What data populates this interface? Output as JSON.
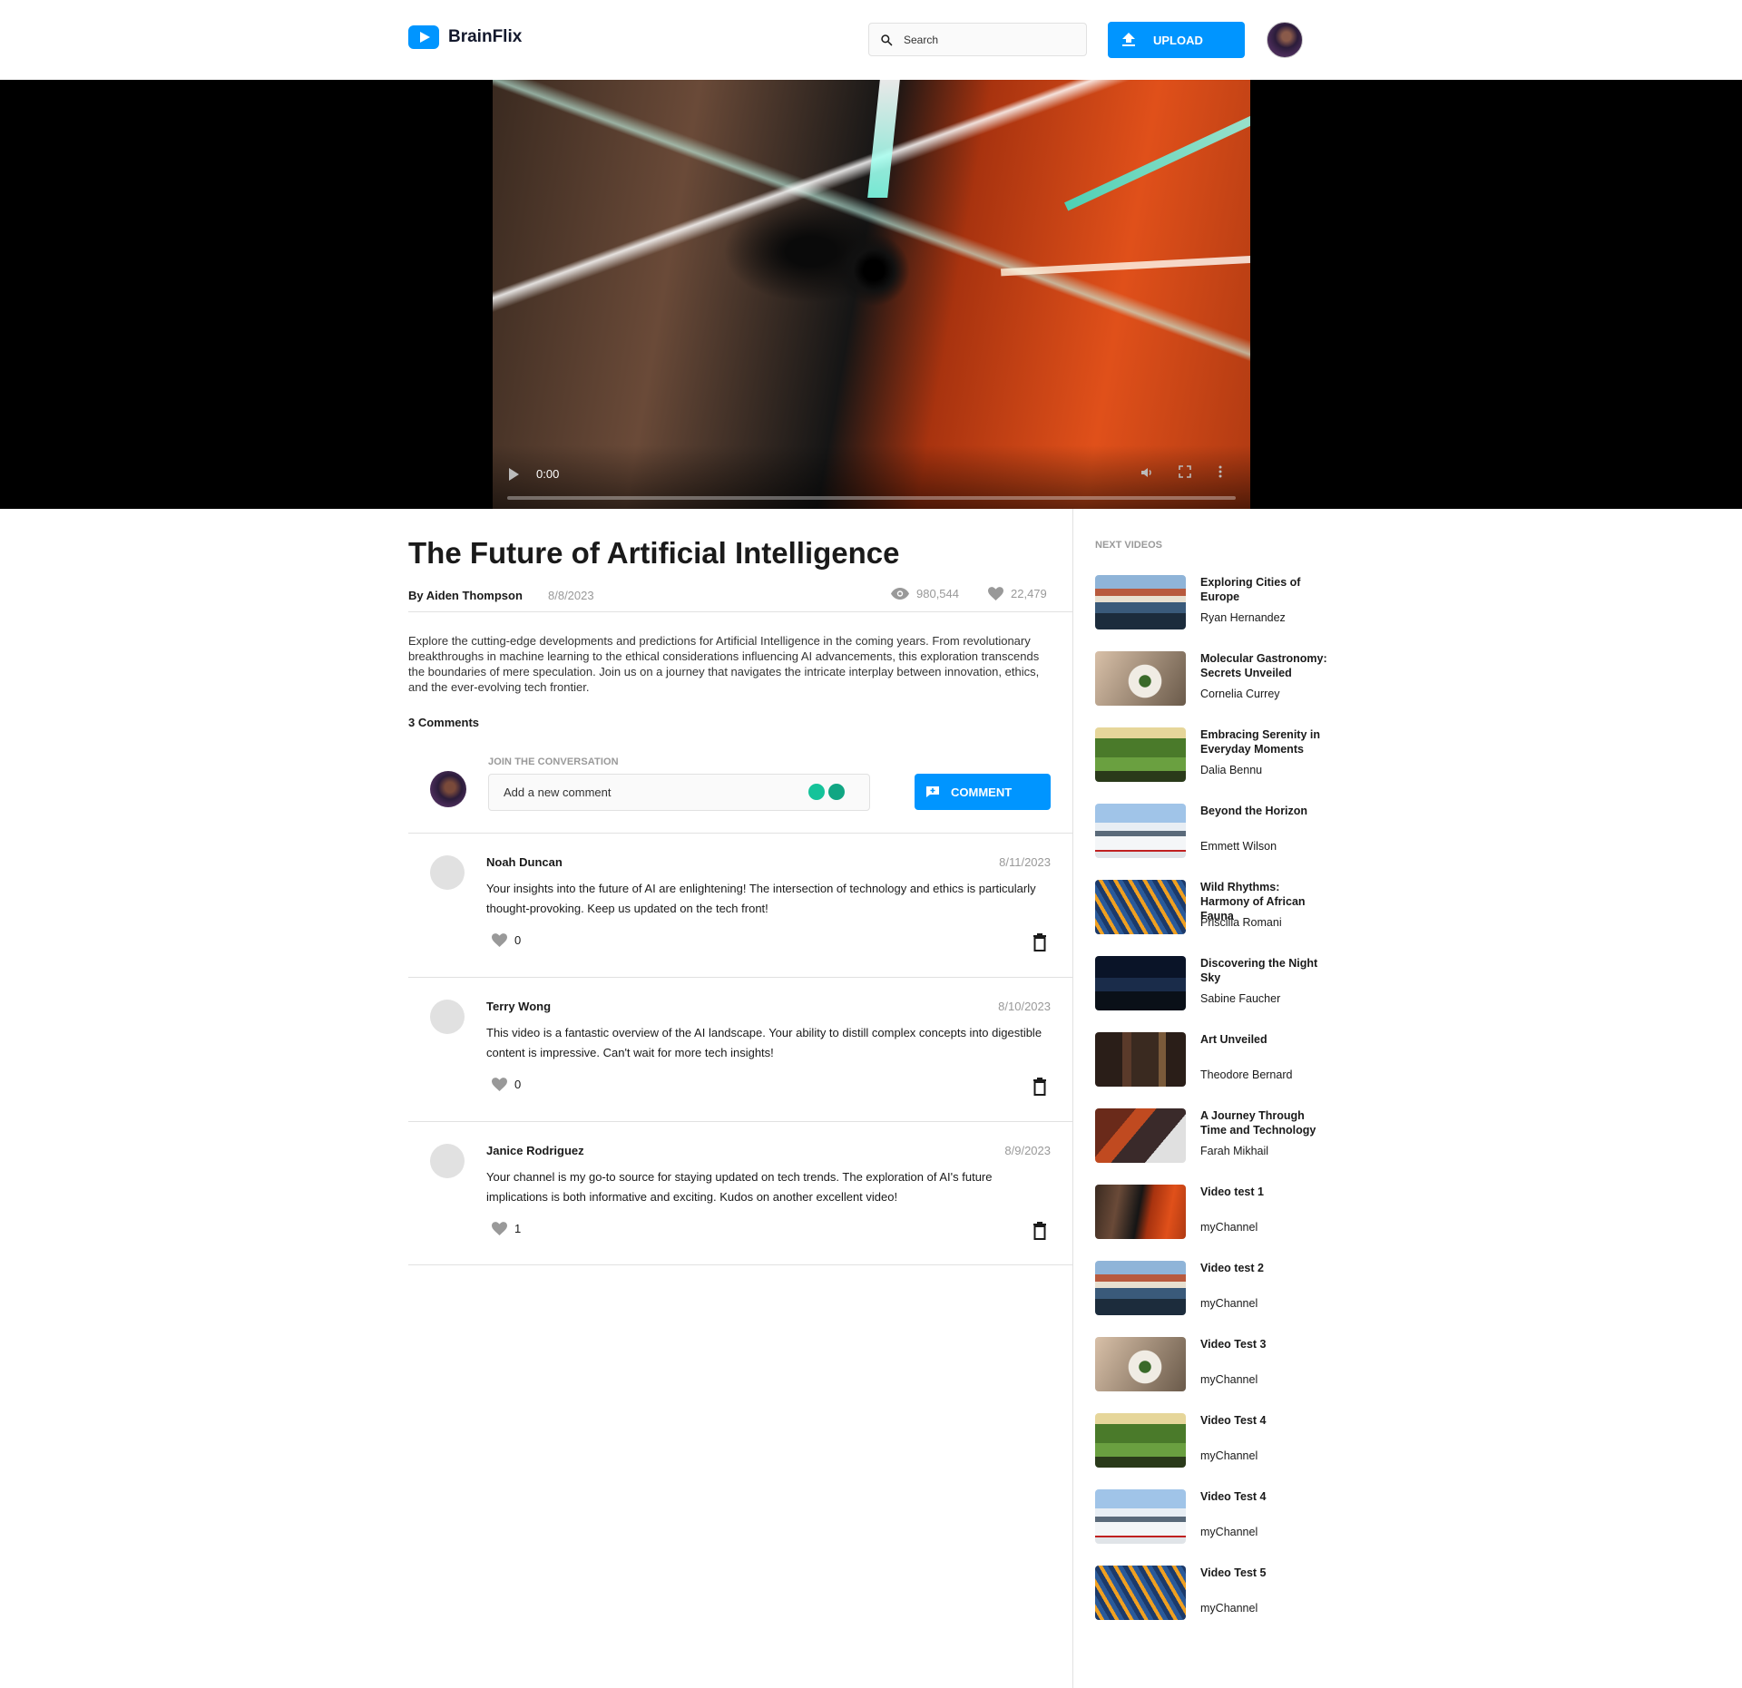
{
  "header": {
    "brand": "BrainFlix",
    "search_placeholder": "Search",
    "upload_label": "UPLOAD"
  },
  "video": {
    "time": "0:00",
    "progress": 0
  },
  "details": {
    "title": "The Future of Artificial Intelligence",
    "author": "By Aiden Thompson",
    "date": "8/8/2023",
    "views": "980,544",
    "likes": "22,479",
    "description": "Explore the cutting-edge developments and predictions for Artificial Intelligence in the coming years. From revolutionary breakthroughs in machine learning to the ethical considerations influencing AI advancements, this exploration transcends the boundaries of mere speculation. Join us on a journey that navigates the intricate interplay between innovation, ethics, and the ever-evolving tech frontier."
  },
  "comments_section": {
    "count_label": "3 Comments",
    "join_label": "JOIN THE CONVERSATION",
    "input_placeholder": "Add a new comment",
    "button_label": "COMMENT",
    "items": [
      {
        "name": "Noah Duncan",
        "date": "8/11/2023",
        "text": "Your insights into the future of AI are enlightening! The intersection of technology and ethics is particularly thought-provoking. Keep us updated on the tech front!",
        "likes": "0"
      },
      {
        "name": "Terry Wong",
        "date": "8/10/2023",
        "text": "This video is a fantastic overview of the AI landscape. Your ability to distill complex concepts into digestible content is impressive. Can't wait for more tech insights!",
        "likes": "0"
      },
      {
        "name": "Janice Rodriguez",
        "date": "8/9/2023",
        "text": "Your channel is my go-to source for staying updated on tech trends. The exploration of AI's future implications is both informative and exciting. Kudos on another excellent video!",
        "likes": "1"
      }
    ]
  },
  "next_videos": {
    "label": "NEXT VIDEOS",
    "items": [
      {
        "title": "Exploring Cities of Europe",
        "channel": "Ryan Hernandez",
        "thumb": "europe"
      },
      {
        "title": "Molecular Gastronomy: Secrets Unveiled",
        "channel": "Cornelia Currey",
        "thumb": "food"
      },
      {
        "title": "Embracing Serenity in Everyday Moments",
        "channel": "Dalia Bennu",
        "thumb": "park"
      },
      {
        "title": "Beyond the Horizon",
        "channel": "Emmett Wilson",
        "thumb": "horizon"
      },
      {
        "title": "Wild Rhythms: Harmony of African Fauna",
        "channel": "Priscilla Romani",
        "thumb": "zebra"
      },
      {
        "title": "Discovering the Night Sky",
        "channel": "Sabine Faucher",
        "thumb": "night"
      },
      {
        "title": "Art Unveiled",
        "channel": "Theodore Bernard",
        "thumb": "art"
      },
      {
        "title": "A Journey Through Time and Technology",
        "channel": "Farah Mikhail",
        "thumb": "train"
      },
      {
        "title": "Video test 1",
        "channel": "myChannel",
        "thumb": "tunnel"
      },
      {
        "title": "Video test 2",
        "channel": "myChannel",
        "thumb": "europe"
      },
      {
        "title": "Video Test 3",
        "channel": "myChannel",
        "thumb": "food"
      },
      {
        "title": "Video Test 4",
        "channel": "myChannel",
        "thumb": "park"
      },
      {
        "title": "Video Test 4",
        "channel": "myChannel",
        "thumb": "horizon"
      },
      {
        "title": "Video Test 5",
        "channel": "myChannel",
        "thumb": "zebra"
      }
    ]
  },
  "colors": {
    "accent": "#0095ff",
    "muted": "#999999",
    "border": "#e1e1e1"
  }
}
